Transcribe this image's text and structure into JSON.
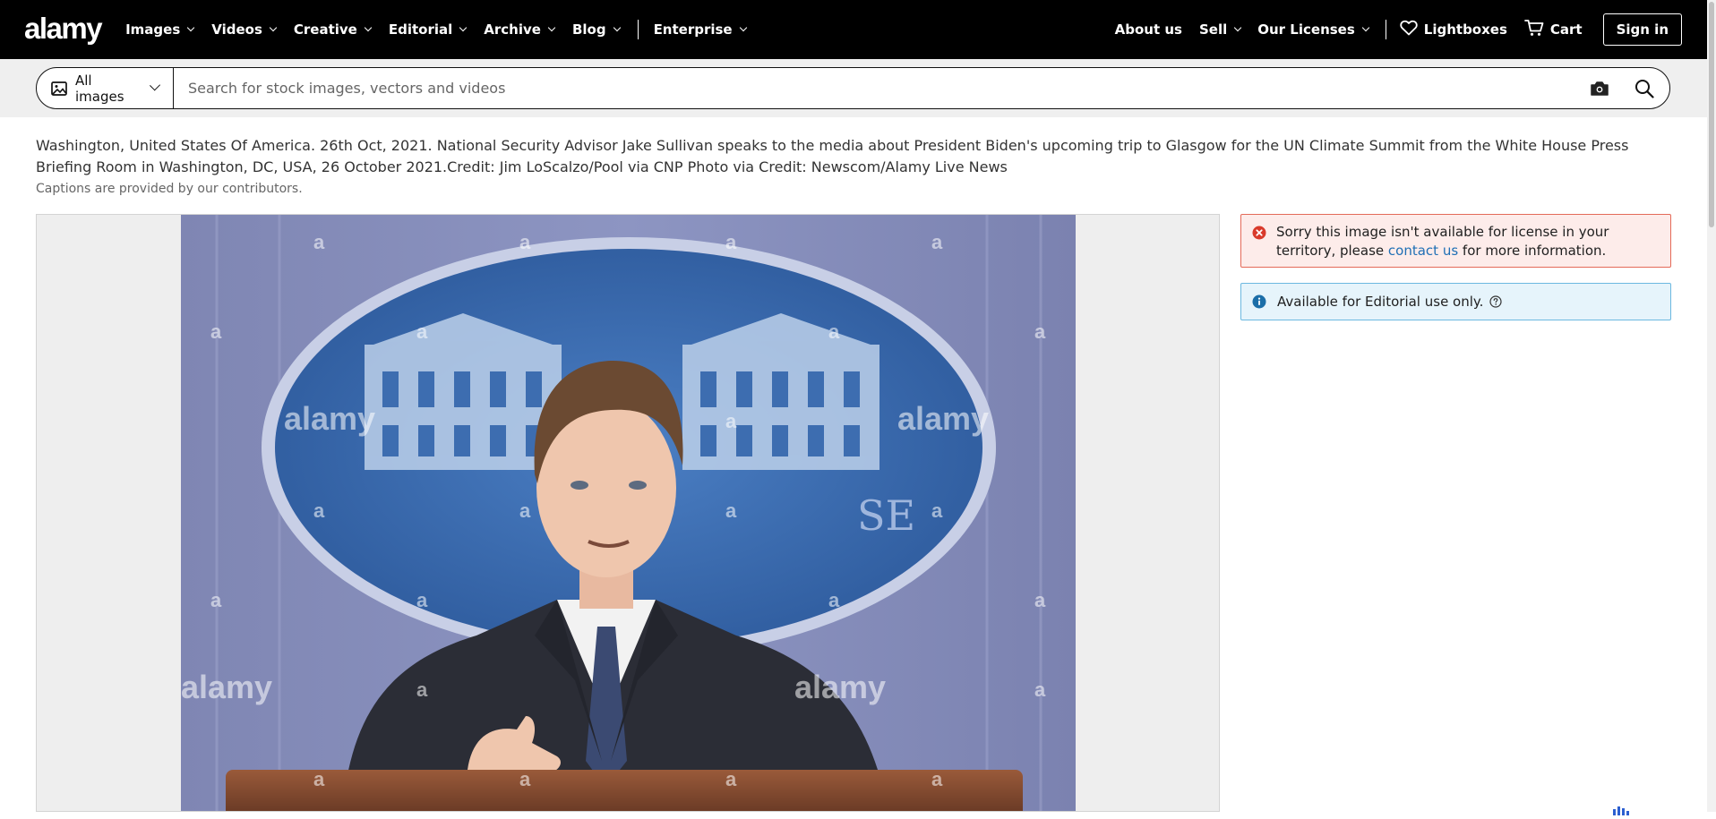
{
  "brand": {
    "logo_text": "alamy"
  },
  "nav": {
    "left_items": [
      "Images",
      "Videos",
      "Creative",
      "Editorial",
      "Archive",
      "Blog"
    ],
    "enterprise": "Enterprise",
    "right": {
      "about": "About us",
      "sell": "Sell",
      "licenses": "Our Licenses",
      "lightboxes": "Lightboxes",
      "cart": "Cart",
      "signin": "Sign in"
    }
  },
  "search": {
    "category": "All images",
    "placeholder": "Search for stock images, vectors and videos",
    "value": ""
  },
  "caption": {
    "text": "Washington, United States Of America. 26th Oct, 2021. National Security Advisor Jake Sullivan speaks to the media about President Biden's upcoming trip to Glasgow for the UN Climate Summit from the White House Press Briefing Room in Washington, DC, USA, 26 October 2021.Credit: Jim LoScalzo/Pool via CNP Photo via Credit: Newscom/Alamy Live News",
    "note": "Captions are provided by our contributors."
  },
  "image": {
    "watermark_small": "a",
    "watermark_large": "alamy",
    "backdrop_text": "SE"
  },
  "alerts": {
    "error": {
      "before_link": "Sorry this image isn't available for license in your territory, please ",
      "link": "contact us",
      "after_link": " for more information."
    },
    "info": {
      "text": "Available for Editorial use only."
    }
  },
  "colors": {
    "nav_bg": "#000000",
    "error_bg": "#fdecea",
    "error_border": "#e46a59",
    "info_bg": "#e6f4fb",
    "info_border": "#6cb8e0",
    "link": "#1f6fb5"
  },
  "icons": {
    "image_category": "image-icon",
    "camera": "camera-icon",
    "search": "search-icon",
    "heart": "heart-icon",
    "cart": "cart-icon",
    "error": "error-circle-icon",
    "info": "info-circle-icon",
    "help": "help-circle-icon"
  }
}
